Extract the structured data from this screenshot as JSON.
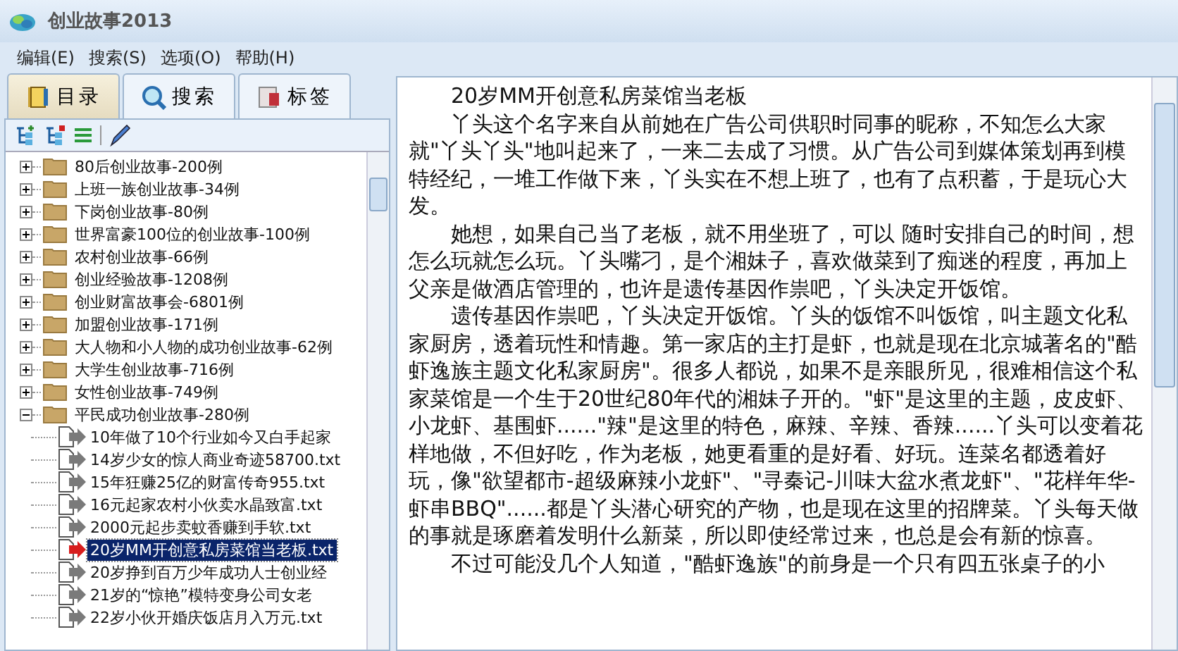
{
  "window": {
    "title": "创业故事2013"
  },
  "menu": [
    {
      "label": "编辑(E)"
    },
    {
      "label": "搜索(S)"
    },
    {
      "label": "选项(O)"
    },
    {
      "label": "帮助(H)"
    }
  ],
  "tabs": [
    {
      "label": "目录",
      "selected": true
    },
    {
      "label": "搜索",
      "selected": false
    },
    {
      "label": "标签",
      "selected": false
    }
  ],
  "tree": [
    {
      "label": "80后创业故事-200例",
      "expanded": false
    },
    {
      "label": "上班一族创业故事-34例",
      "expanded": false
    },
    {
      "label": "下岗创业故事-80例",
      "expanded": false
    },
    {
      "label": "世界富豪100位的创业故事-100例",
      "expanded": false
    },
    {
      "label": "农村创业故事-66例",
      "expanded": false
    },
    {
      "label": "创业经验故事-1208例",
      "expanded": false
    },
    {
      "label": "创业财富故事会-6801例",
      "expanded": false
    },
    {
      "label": "加盟创业故事-171例",
      "expanded": false
    },
    {
      "label": "大人物和小人物的成功创业故事-62例",
      "expanded": false
    },
    {
      "label": "大学生创业故事-716例",
      "expanded": false
    },
    {
      "label": "女性创业故事-749例",
      "expanded": false
    },
    {
      "label": "平民成功创业故事-280例",
      "expanded": true,
      "children": [
        {
          "label": "10年做了10个行业如今又白手起家",
          "selected": false
        },
        {
          "label": "14岁少女的惊人商业奇迹58700.txt",
          "selected": false
        },
        {
          "label": "15年狂赚25亿的财富传奇955.txt",
          "selected": false
        },
        {
          "label": "16元起家农村小伙卖水晶致富.txt",
          "selected": false
        },
        {
          "label": "2000元起步卖蚊香赚到手软.txt",
          "selected": false
        },
        {
          "label": "20岁MM开创意私房菜馆当老板.txt",
          "selected": true
        },
        {
          "label": "20岁挣到百万少年成功人士创业经",
          "selected": false
        },
        {
          "label": "21岁的“惊艳”模特变身公司女老",
          "selected": false
        },
        {
          "label": "22岁小伙开婚庆饭店月入万元.txt",
          "selected": false
        }
      ]
    }
  ],
  "document": {
    "title": "20岁MM开创意私房菜馆当老板",
    "paragraphs": [
      "丫头这个名字来自从前她在广告公司供职时同事的昵称，不知怎么大家就\"丫头丫头\"地叫起来了，一来二去成了习惯。从广告公司到媒体策划再到模特经纪，一堆工作做下来，丫头实在不想上班了，也有了点积蓄，于是玩心大发。",
      "她想，如果自己当了老板，就不用坐班了，可以 随时安排自己的时间，想怎么玩就怎么玩。丫头嘴刁，是个湘妹子，喜欢做菜到了痴迷的程度，再加上父亲是做酒店管理的，也许是遗传基因作祟吧，丫头决定开饭馆。",
      "遗传基因作祟吧，丫头决定开饭馆。丫头的饭馆不叫饭馆，叫主题文化私家厨房，透着玩性和情趣。第一家店的主打是虾，也就是现在北京城著名的\"酷虾逸族主题文化私家厨房\"。很多人都说，如果不是亲眼所见，很难相信这个私家菜馆是一个生于20世纪80年代的湘妹子开的。\"虾\"是这里的主题，皮皮虾、小龙虾、基围虾......\"辣\"是这里的特色，麻辣、辛辣、香辣......丫头可以变着花样地做，不但好吃，作为老板，她更看重的是好看、好玩。连菜名都透着好玩，像\"欲望都市-超级麻辣小龙虾\"、\"寻秦记-川味大盆水煮龙虾\"、\"花样年华-虾串BBQ\"......都是丫头潜心研究的产物，也是现在这里的招牌菜。丫头每天做的事就是琢磨着发明什么新菜，所以即使经常过来，也总是会有新的惊喜。",
      "不过可能没几个人知道，\"酷虾逸族\"的前身是一个只有四五张桌子的小"
    ]
  }
}
